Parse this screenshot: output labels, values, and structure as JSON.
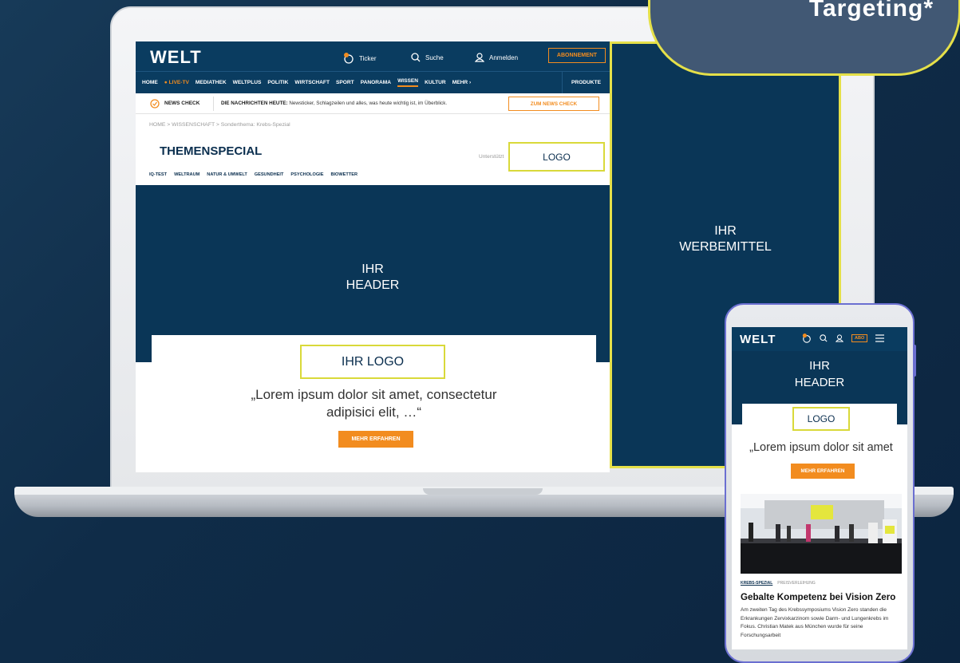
{
  "bubble": {
    "text": "Targeting*"
  },
  "desktop": {
    "logo": "WELT",
    "topbar": {
      "ticker": "Ticker",
      "search": "Suche",
      "login": "Anmelden",
      "abo": "ABONNEMENT"
    },
    "nav": [
      "HOME",
      "LIVE-TV",
      "MEDIATHEK",
      "WELTPLUS",
      "POLITIK",
      "WIRTSCHAFT",
      "SPORT",
      "PANORAMA",
      "WISSEN",
      "KULTUR",
      "MEHR"
    ],
    "nav_products": "PRODUKTE",
    "newscheck": {
      "label": "NEWS CHECK",
      "headline_bold": "DIE NACHRICHTEN HEUTE:",
      "headline_text": "Newsticker, Schlagzeilen und alles, was heute wichtig ist, im Überblick.",
      "button": "ZUM NEWS CHECK"
    },
    "breadcrumb": "HOME > WISSENSCHAFT > Sonderthema: Krebs-Spezial",
    "special_title": "THEMENSPECIAL",
    "sponsor_label": "Unterstützt",
    "logo_box": "LOGO",
    "subnav": [
      "IQ-TEST",
      "WELTRAUM",
      "NATUR & UMWELT",
      "GESUNDHEIT",
      "PSYCHOLOGIE",
      "BIOWETTER"
    ],
    "header": {
      "line1": "IHR",
      "line2": "HEADER"
    },
    "teaser": {
      "logo": "IHR LOGO",
      "quote_line1": "„Lorem ipsum dolor sit amet, consectetur",
      "quote_line2": "adipisici elit, …“",
      "button": "MEHR ERFAHREN"
    },
    "ad": {
      "line1": "IHR",
      "line2": "WERBEMITTEL"
    }
  },
  "mobile": {
    "logo": "WELT",
    "abo": "ABO",
    "header": {
      "line1": "IHR",
      "line2": "HEADER"
    },
    "logo_box": "LOGO",
    "quote": "„Lorem ipsum dolor sit amet",
    "button": "MEHR ERFAHREN",
    "tag_primary": "KREBS-SPEZIAL",
    "tag_secondary": "PREISVERLEIHUNG",
    "article_title": "Gebalte Kompetenz bei Vision Zero",
    "article_body": "Am zweiten Tag des Krebssymposiums Vision Zero standen die Erkrankungen Zervixkarzinom sowie Darm- und Lungenkrebs im Fokus. Christian Matek aus München wurde für seine Forschungsarbeit"
  },
  "colors": {
    "brand_navy": "#0a3657",
    "accent_orange": "#f28c1f",
    "highlight_yellow": "#e5e049"
  }
}
